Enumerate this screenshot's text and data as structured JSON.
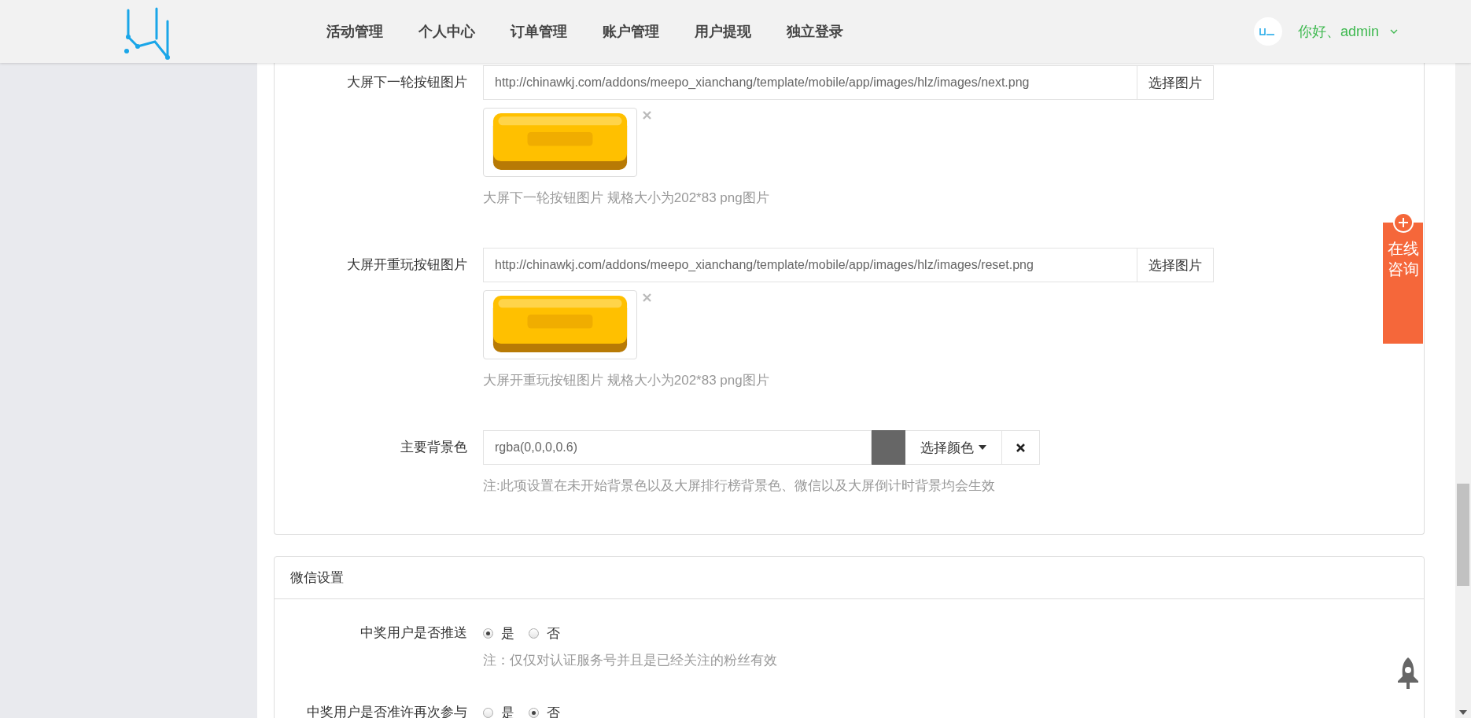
{
  "header": {
    "nav": [
      {
        "label": "活动管理"
      },
      {
        "label": "个人中心"
      },
      {
        "label": "订单管理"
      },
      {
        "label": "账户管理"
      },
      {
        "label": "用户提现"
      },
      {
        "label": "独立登录"
      }
    ],
    "greeting": "你好、admin"
  },
  "image_fields": [
    {
      "label": "大屏下一轮按钮图片",
      "value": "http://chinawkj.com/addons/meepo_xianchang/template/mobile/app/images/hlz/images/next.png",
      "button": "选择图片",
      "help": "大屏下一轮按钮图片 规格大小为202*83 png图片"
    },
    {
      "label": "大屏开重玩按钮图片",
      "value": "http://chinawkj.com/addons/meepo_xianchang/template/mobile/app/images/hlz/images/reset.png",
      "button": "选择图片",
      "help": "大屏开重玩按钮图片 规格大小为202*83 png图片"
    }
  ],
  "color_field": {
    "label": "主要背景色",
    "value": "rgba(0,0,0,0.6)",
    "color": "#666666",
    "button": "选择颜色",
    "help": "注:此项设置在未开始背景色以及大屏排行榜背景色、微信以及大屏倒计时背景均会生效"
  },
  "wechat_section": {
    "title": "微信设置",
    "rows": [
      {
        "label": "中奖用户是否推送",
        "options": [
          {
            "label": "是",
            "selected": true
          },
          {
            "label": "否",
            "selected": false
          }
        ],
        "note": "注：仅仅对认证服务号并且是已经关注的粉丝有效"
      },
      {
        "label": "中奖用户是否准许再次参与",
        "options": [
          {
            "label": "是",
            "selected": false
          },
          {
            "label": "否",
            "selected": true
          }
        ]
      }
    ]
  },
  "consult_widget": {
    "label": "在线咨询"
  }
}
